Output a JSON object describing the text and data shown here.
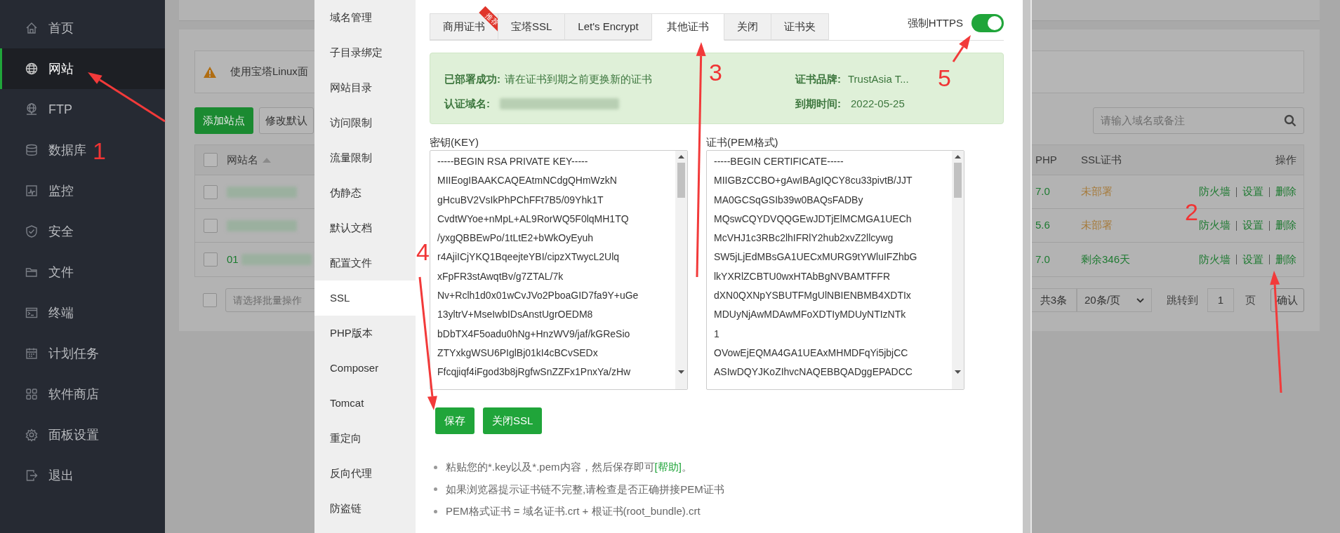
{
  "sidebar": {
    "items": [
      {
        "label": "首页",
        "selected": false
      },
      {
        "label": "网站",
        "selected": true
      },
      {
        "label": "FTP",
        "selected": false
      },
      {
        "label": "数据库",
        "selected": false
      },
      {
        "label": "监控",
        "selected": false
      },
      {
        "label": "安全",
        "selected": false
      },
      {
        "label": "文件",
        "selected": false
      },
      {
        "label": "终端",
        "selected": false
      },
      {
        "label": "计划任务",
        "selected": false
      },
      {
        "label": "软件商店",
        "selected": false
      },
      {
        "label": "面板设置",
        "selected": false
      },
      {
        "label": "退出",
        "selected": false
      }
    ]
  },
  "background_page": {
    "alert": {
      "text": "使用宝塔Linux面"
    },
    "buttons": [
      {
        "label": "添加站点",
        "kind": "primary"
      },
      {
        "label": "修改默认",
        "kind": "default"
      }
    ],
    "search": {
      "placeholder": "请输入域名或备注"
    },
    "table": {
      "columns": [
        "网站名",
        "PHP",
        "SSL证书",
        "操作"
      ],
      "select_all_checked": false,
      "rows": [
        {
          "checked": false,
          "php": "7.0",
          "ssl": "未部署",
          "ssl_deployed": false,
          "actions": [
            "防火墙",
            "设置",
            "删除"
          ]
        },
        {
          "checked": false,
          "php": "5.6",
          "ssl": "未部署",
          "ssl_deployed": false,
          "actions": [
            "防火墙",
            "设置",
            "删除"
          ]
        },
        {
          "checked": false,
          "name": "01",
          "php": "7.0",
          "ssl": "剩余346天",
          "ssl_deployed": true,
          "actions": [
            "防火墙",
            "设置",
            "删除"
          ]
        }
      ]
    },
    "batch_checked": false,
    "batch_select": {
      "placeholder": "请选择批量操作"
    },
    "pagination": {
      "total": "共3条",
      "page_size": "20条/页",
      "jump_label": "跳转到",
      "page": "1",
      "page_unit": "页",
      "confirm": "确认"
    }
  },
  "modal": {
    "menu": [
      {
        "label": "域名管理",
        "selected": false
      },
      {
        "label": "子目录绑定",
        "selected": false
      },
      {
        "label": "网站目录",
        "selected": false
      },
      {
        "label": "访问限制",
        "selected": false
      },
      {
        "label": "流量限制",
        "selected": false
      },
      {
        "label": "伪静态",
        "selected": false
      },
      {
        "label": "默认文档",
        "selected": false
      },
      {
        "label": "配置文件",
        "selected": false
      },
      {
        "label": "SSL",
        "selected": true
      },
      {
        "label": "PHP版本",
        "selected": false
      },
      {
        "label": "Composer",
        "selected": false
      },
      {
        "label": "Tomcat",
        "selected": false
      },
      {
        "label": "重定向",
        "selected": false
      },
      {
        "label": "反向代理",
        "selected": false
      },
      {
        "label": "防盗链",
        "selected": false
      }
    ],
    "tabs": [
      {
        "label": "商用证书",
        "selected": false,
        "badge": "推荐"
      },
      {
        "label": "宝塔SSL",
        "selected": false
      },
      {
        "label": "Let's Encrypt",
        "selected": false
      },
      {
        "label": "其他证书",
        "selected": true
      },
      {
        "label": "关闭",
        "selected": false
      },
      {
        "label": "证书夹",
        "selected": false
      }
    ],
    "force_https": {
      "label": "强制HTTPS",
      "on": true
    },
    "status": {
      "deployed_label": "已部署成功:",
      "deployed_text": "请在证书到期之前更换新的证书",
      "domain_label": "认证域名:",
      "brand_label": "证书品牌:",
      "brand": "TrustAsia T...",
      "expiry_label": "到期时间:",
      "expiry": "2022-05-25"
    },
    "key": {
      "label": "密钥(KEY)",
      "lines": [
        "-----BEGIN RSA PRIVATE KEY-----",
        "MIIEogIBAAKCAQEAtmNCdgQHmWzkN",
        "gHcuBV2VsIkPhPChFFt7B5/09Yhk1T",
        "CvdtWYoe+nMpL+AL9RorWQ5F0lqMH1TQ",
        "/yxgQBBEwPo/1tLtE2+bWkOyEyuh",
        "r4AjiICjYKQ1BqeejteYBI/cipzXTwycL2Ulq",
        "xFpFR3stAwqtBv/g7ZTAL/7k",
        "Nv+Rclh1d0x01wCvJVo2PboaGID7fa9Y+uGe",
        "13yltrV+MseIwbIDsAnstUgrOEDM8",
        "bDbTX4F5oadu0hNg+HnzWV9/jaf/kGReSio",
        "ZTYxkgWSU6PIglBj01kI4cBCvSEDx",
        "Ffcqjiqf4iFgod3b8jRgfwSnZZFx1PnxYa/zHw"
      ]
    },
    "cert": {
      "label": "证书(PEM格式)",
      "lines": [
        "-----BEGIN CERTIFICATE-----",
        "MIIGBzCCBO+gAwIBAgIQCY8cu33pivtB/JJT",
        "MA0GCSqGSIb39w0BAQsFADBy",
        "MQswCQYDVQQGEwJDTjElMCMGA1UECh",
        "McVHJ1c3RBc2lhIFRlY2hub2xvZ2llcywg",
        "SW5jLjEdMBsGA1UECxMURG9tYWluIFZhbG",
        "lkYXRlZCBTU0wxHTAbBgNVBAMTFFR",
        "dXN0QXNpYSBUTFMgUlNBIENBMB4XDTIx",
        "MDUyNjAwMDAwMFoXDTIyMDUyNTIzNTk",
        "1",
        "OVowEjEQMA4GA1UEAxMHMDFqYi5jbjCC",
        "ASIwDQYJKoZIhvcNAQEBBQADggEPADCC"
      ]
    },
    "buttons": [
      "保存",
      "关闭SSL"
    ],
    "notes": [
      {
        "text": "粘贴您的*.key以及*.pem内容，然后保存即可",
        "link": "[帮助]",
        "suffix": "。"
      },
      {
        "text": "如果浏览器提示证书链不完整,请检查是否正确拼接PEM证书"
      },
      {
        "text": "PEM格式证书 = 域名证书.crt + 根证书(root_bundle).crt"
      }
    ]
  },
  "annotations": {
    "numbers": [
      "1",
      "2",
      "3",
      "4",
      "5"
    ]
  }
}
